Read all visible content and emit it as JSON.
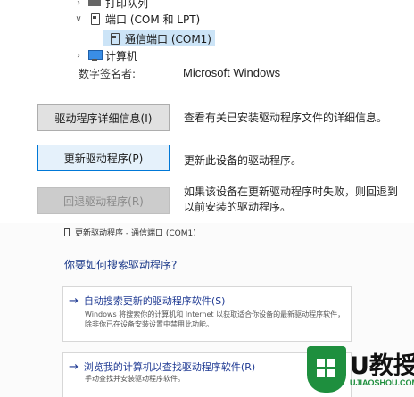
{
  "tree": {
    "printers_label": "打印队列",
    "ports_label": "端口 (COM 和 LPT)",
    "com1_label": "通信端口 (COM1)",
    "computer_label": "计算机"
  },
  "properties": {
    "signer_label": "数字签名者:",
    "signer_value": "Microsoft Windows",
    "details_button": "驱动程序详细信息(I)",
    "details_desc": "查看有关已安装驱动程序文件的详细信息。",
    "update_button": "更新驱动程序(P)",
    "update_desc": "更新此设备的驱动程序。",
    "rollback_button": "回退驱动程序(R)",
    "rollback_desc_line1": "如果该设备在更新驱动程序时失败，则回退到",
    "rollback_desc_line2": "以前安装的驱动程序。"
  },
  "wizard": {
    "title": "更新驱动程序 - 通信端口 (COM1)",
    "question": "你要如何搜索驱动程序?",
    "auto_option": {
      "title": "自动搜索更新的驱动程序软件(S)",
      "desc_line1": "Windows 将搜索你的计算机和 Internet 以获取适合你设备的最新驱动程序软件，",
      "desc_line2": "除非你已在设备安装设置中禁用此功能。"
    },
    "browse_option": {
      "title": "浏览我的计算机以查找驱动程序软件(R)",
      "desc_line1": "手动查找并安装驱动程序软件。"
    }
  },
  "watermark": {
    "brand": "U教授",
    "url": "UJIAOSHOU.COM"
  },
  "colors": {
    "selection": "#cce4f7",
    "link_blue": "#1f3a93",
    "brand_green": "#1e8f3e"
  },
  "icons": {
    "expand": "chevron-right-icon",
    "collapse": "chevron-down-icon",
    "port": "port-icon",
    "computer": "monitor-icon",
    "option_arrow": "arrow-right-icon"
  }
}
